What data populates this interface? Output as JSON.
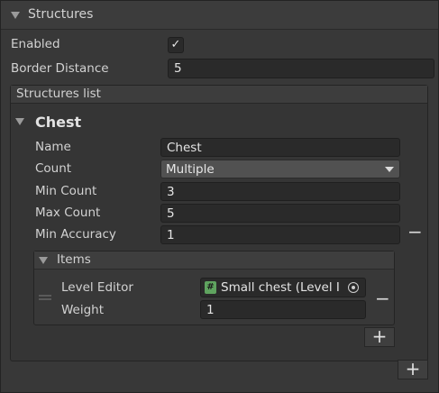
{
  "header": {
    "title": "Structures"
  },
  "enabled": {
    "label": "Enabled",
    "checked_glyph": "✓"
  },
  "border_distance": {
    "label": "Border Distance",
    "value": "5"
  },
  "structures_list": {
    "label": "Structures list",
    "element": {
      "title": "Chest",
      "name": {
        "label": "Name",
        "value": "Chest"
      },
      "count": {
        "label": "Count",
        "value": "Multiple"
      },
      "min_count": {
        "label": "Min Count",
        "value": "3"
      },
      "max_count": {
        "label": "Max Count",
        "value": "5"
      },
      "min_accuracy": {
        "label": "Min Accuracy",
        "value": "1"
      },
      "items": {
        "label": "Items",
        "entry": {
          "level_editor": {
            "label": "Level Editor",
            "value": "Small chest (Level I",
            "icon": "#"
          },
          "weight": {
            "label": "Weight",
            "value": "1"
          }
        }
      }
    }
  },
  "buttons": {
    "plus": "+",
    "minus": "−"
  }
}
